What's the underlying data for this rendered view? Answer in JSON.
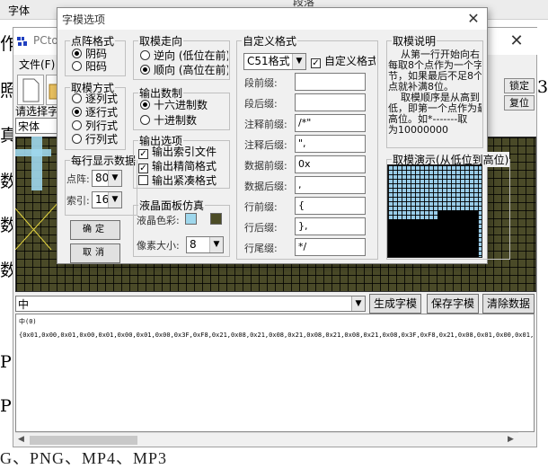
{
  "background_doc": {
    "top_left": "字体",
    "top_mid": "段落",
    "left_chars": [
      "作",
      "照",
      "真",
      "数",
      "数",
      "数",
      "P",
      "P"
    ],
    "right_char": "3",
    "bottom_line": "G、PNG、MP4、MP3"
  },
  "main_window": {
    "title": "PCto",
    "menu_file": "文件(F)",
    "select_label": "请选择字",
    "font_value": "宋体",
    "side_buttons": [
      "锁定",
      "复位"
    ],
    "char_input_value": "中",
    "buttons": {
      "generate": "生成字模",
      "save": "保存字模",
      "clear": "清除数据"
    },
    "output": {
      "line1": "中(0)",
      "line2": "{0x01,0x00,0x01,0x00,0x01,0x00,0x01,0x00,0x3F,0xF8,0x21,0x08,0x21,0x08,0x21,0x08,0x21,0x08,0x21,0x08,0x3F,0xF8,0x21,0x08,0x01,0x00,0x01,0x00"
    }
  },
  "dialog": {
    "title": "字模选项",
    "dot_format": {
      "legend": "点阵格式",
      "options": [
        "阴码",
        "阳码"
      ],
      "selected": 0
    },
    "scan_mode": {
      "legend": "取模方式",
      "options": [
        "逐列式",
        "逐行式",
        "列行式",
        "行列式"
      ],
      "selected": 1
    },
    "per_line": {
      "legend": "每行显示数据",
      "dots_label": "点阵:",
      "dots_value": "80",
      "index_label": "索引:",
      "index_value": "16"
    },
    "buttons": {
      "ok": "确定",
      "cancel": "取消"
    },
    "direction": {
      "legend": "取模走向",
      "options": [
        "逆向 (低位在前)",
        "顺向 (高位在前)"
      ],
      "selected": 1
    },
    "number_base": {
      "legend": "输出数制",
      "options": [
        "十六进制数",
        "十进制数"
      ],
      "selected": 0
    },
    "output_opts": {
      "legend": "输出选项",
      "options": [
        "输出索引文件",
        "输出精简格式",
        "输出紧凑格式"
      ],
      "checked": [
        true,
        true,
        false
      ]
    },
    "lcd_sim": {
      "legend": "液晶面板仿真",
      "color_label": "液晶色彩:",
      "pixel_label": "像素大小:",
      "pixel_value": "8",
      "color_lcd": "#9fd7ec",
      "color_dark": "#4c4c26"
    },
    "custom_format": {
      "legend": "自定义格式",
      "format_value": "C51格式",
      "custom_check_label": "自定义格式",
      "custom_checked": true,
      "fields": [
        {
          "label": "段前缀:",
          "value": ""
        },
        {
          "label": "段后缀:",
          "value": ""
        },
        {
          "label": "注释前缀:",
          "value": "/*\""
        },
        {
          "label": "注释后缀:",
          "value": "\","
        },
        {
          "label": "数据前缀:",
          "value": "0x"
        },
        {
          "label": "数据后缀:",
          "value": ","
        },
        {
          "label": "行前缀:",
          "value": "{"
        },
        {
          "label": "行后缀:",
          "value": "},"
        },
        {
          "label": "行尾缀:",
          "value": "*/"
        }
      ]
    },
    "explain": {
      "legend": "取模说明",
      "text": "    从第一行开始向右\n每取8个点作为一个字\n节，如果最后不足8个\n点就补满8位。\n    取模顺序是从高到\n低，即第一个点作为最\n高位。如*-------取\n为10000000"
    },
    "demo": {
      "legend": "取模演示(从低位到高位)"
    }
  }
}
